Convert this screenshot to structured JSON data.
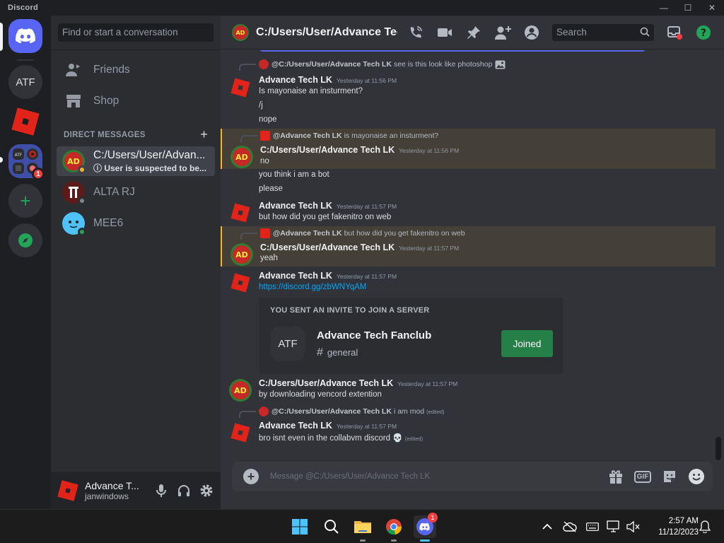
{
  "titlebar": {
    "app_name": "Discord",
    "min": "—",
    "max": "☐",
    "close": "✕"
  },
  "rail": {
    "home_label": "Direct Messages",
    "servers": [
      {
        "label": "ATF"
      },
      {
        "label": "Roblox"
      },
      {
        "label": "Folder",
        "badge": "1"
      }
    ]
  },
  "sidebar": {
    "search_placeholder": "Find or start a conversation",
    "nav": [
      {
        "label": "Friends"
      },
      {
        "label": "Shop"
      }
    ],
    "dm_header": "DIRECT MESSAGES",
    "dm_add": "+",
    "dms": [
      {
        "name": "C:/Users/User/Advan...",
        "sub": "ⓘ User is suspected to be...",
        "active": true
      },
      {
        "name": "ALTA RJ"
      },
      {
        "name": "MEE6"
      }
    ],
    "user": {
      "name": "Advance T...",
      "tag": "janwindows"
    }
  },
  "header": {
    "title": "C:/Users/User/Advance Tech LK",
    "search_placeholder": "Search"
  },
  "colors": {
    "blurple": "#5865f2",
    "green": "#23a559",
    "red": "#f23f43",
    "link": "#00a8fc",
    "mention_bar": "#f0b232"
  },
  "messages": [
    {
      "reply": {
        "author": "@C:/Users/User/Advance Tech LK",
        "text": "see is this look like photoshop"
      }
    },
    {
      "author": "Advance Tech LK",
      "time": "Yesterday at 11:56 PM",
      "lines": [
        "Is mayonaise an insturment?",
        "/j",
        "nope"
      ]
    },
    {
      "reply": {
        "author": "@Advance Tech LK",
        "text": "is mayonaise an insturment?"
      },
      "author": "C:/Users/User/Advance Tech LK",
      "time": "Yesterday at 11:56 PM",
      "lines": [
        "no",
        "you think i am a bot",
        "please"
      ]
    },
    {
      "author": "Advance Tech LK",
      "time": "Yesterday at 11:57 PM",
      "lines": [
        "but how did you get fakenitro on web"
      ]
    },
    {
      "reply": {
        "author": "@Advance Tech LK",
        "text": "but how did you get fakenitro on web"
      },
      "author": "C:/Users/User/Advance Tech LK",
      "time": "Yesterday at 11:57 PM",
      "lines": [
        "yeah"
      ]
    },
    {
      "author": "Advance Tech LK",
      "time": "Yesterday at 11:57 PM",
      "lines": [
        "https://discord.gg/zbWNYqAM"
      ]
    },
    {
      "author": "C:/Users/User/Advance Tech LK",
      "time": "Yesterday at 11:57 PM",
      "lines": [
        "by downloading vencord extention"
      ]
    },
    {
      "reply": {
        "author": "@C:/Users/User/Advance Tech LK",
        "text": "i am mod",
        "edited": "(edited)"
      },
      "author": "Advance Tech LK",
      "time": "Yesterday at 11:57 PM",
      "lines": [
        "bro isnt even in the collabvm discord 💀"
      ],
      "edited": "(edited)"
    }
  ],
  "invite": {
    "heading": "YOU SENT AN INVITE TO JOIN A SERVER",
    "icon_label": "ATF",
    "server_name": "Advance Tech Fanclub",
    "channel_hash": "#",
    "channel": "general",
    "button": "Joined"
  },
  "composer": {
    "placeholder": "Message @C:/Users/User/Advance Tech LK",
    "gif": "GIF"
  },
  "taskbar": {
    "discord_badge": "1",
    "time": "2:57 AM",
    "date": "11/12/2023"
  }
}
